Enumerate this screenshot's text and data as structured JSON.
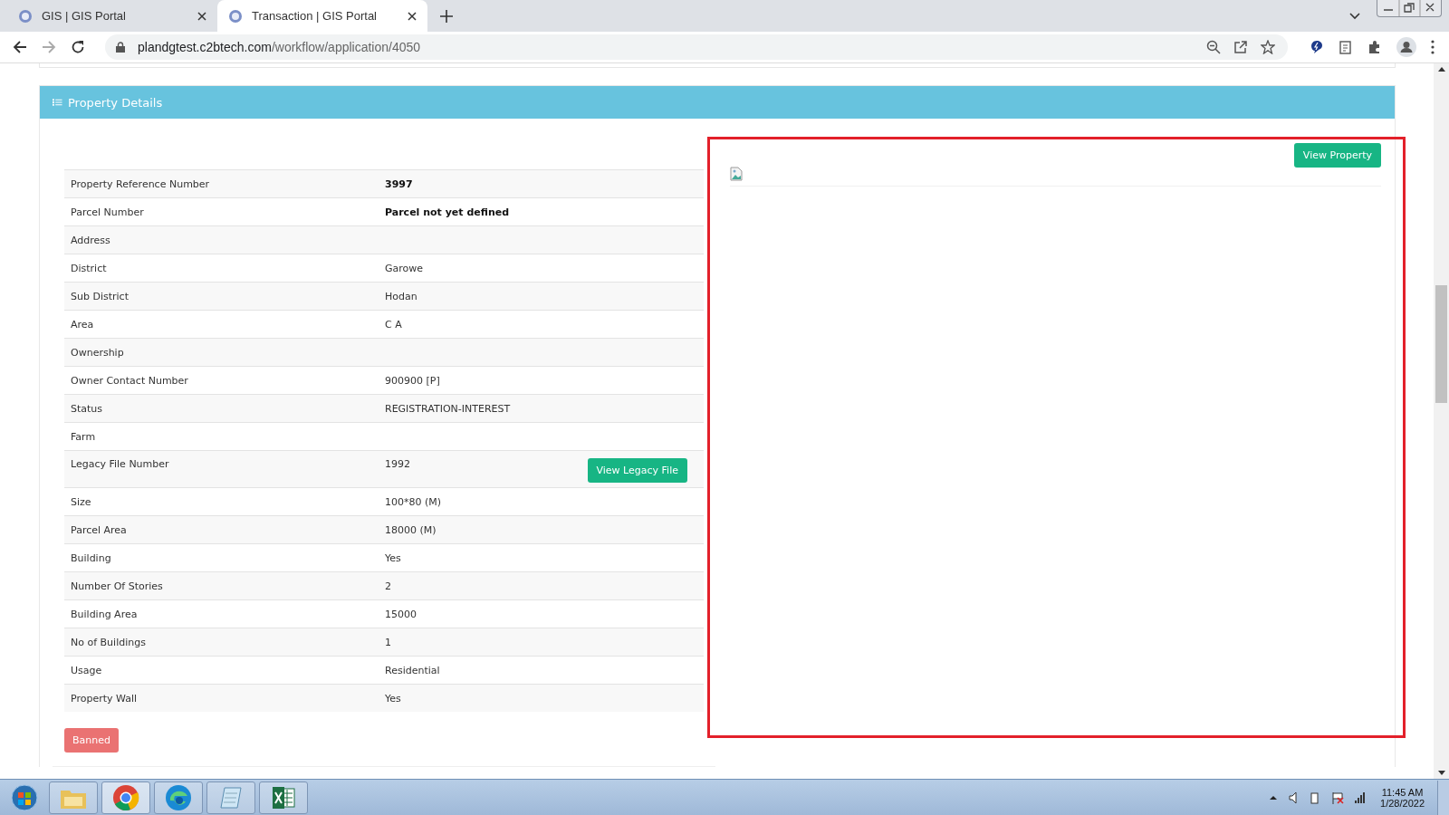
{
  "browser": {
    "tabs": [
      {
        "title": "GIS | GIS Portal",
        "selected": false
      },
      {
        "title": "Transaction | GIS Portal",
        "selected": true
      }
    ],
    "url_host": "plandgtest.c2btech.com",
    "url_path": "/workflow/application/4050"
  },
  "panel": {
    "title": "Property Details",
    "rows": [
      {
        "label": "Property Reference Number",
        "value": "3997",
        "emphasized": true
      },
      {
        "label": "Parcel Number",
        "value": "Parcel not yet defined",
        "emphasized": true
      },
      {
        "label": "Address"
      },
      {
        "label": "District",
        "value": "Garowe",
        "emphasized": false
      },
      {
        "label": "Sub District",
        "value": "Hodan",
        "emphasized": false
      },
      {
        "label": "Area",
        "value": "C A",
        "emphasized": false
      },
      {
        "label": "Ownership"
      },
      {
        "label": "Owner Contact Number",
        "value": "900900 [P]",
        "emphasized": false
      },
      {
        "label": "Status",
        "value": "REGISTRATION-INTEREST",
        "emphasized": false
      },
      {
        "label": "Farm"
      },
      {
        "label": "Legacy File Number",
        "value": "1992",
        "emphasized": false,
        "action": "View Legacy File"
      },
      {
        "label": "Size",
        "value": "100*80 (M)",
        "emphasized": false
      },
      {
        "label": "Parcel Area",
        "value": "18000 (M)",
        "emphasized": false
      },
      {
        "label": "Building",
        "value": "Yes",
        "emphasized": false
      },
      {
        "label": "Number Of Stories",
        "value": "2",
        "emphasized": false
      },
      {
        "label": "Building Area",
        "value": "15000",
        "emphasized": false
      },
      {
        "label": "No of Buildings",
        "value": "1",
        "emphasized": false
      },
      {
        "label": "Usage",
        "value": "Residential",
        "emphasized": false
      },
      {
        "label": "Property Wall",
        "value": "Yes",
        "emphasized": false
      }
    ],
    "status_button": "Banned",
    "view_property_button": "View Property"
  },
  "taskbar": {
    "time": "11:45 AM",
    "date": "1/28/2022"
  }
}
